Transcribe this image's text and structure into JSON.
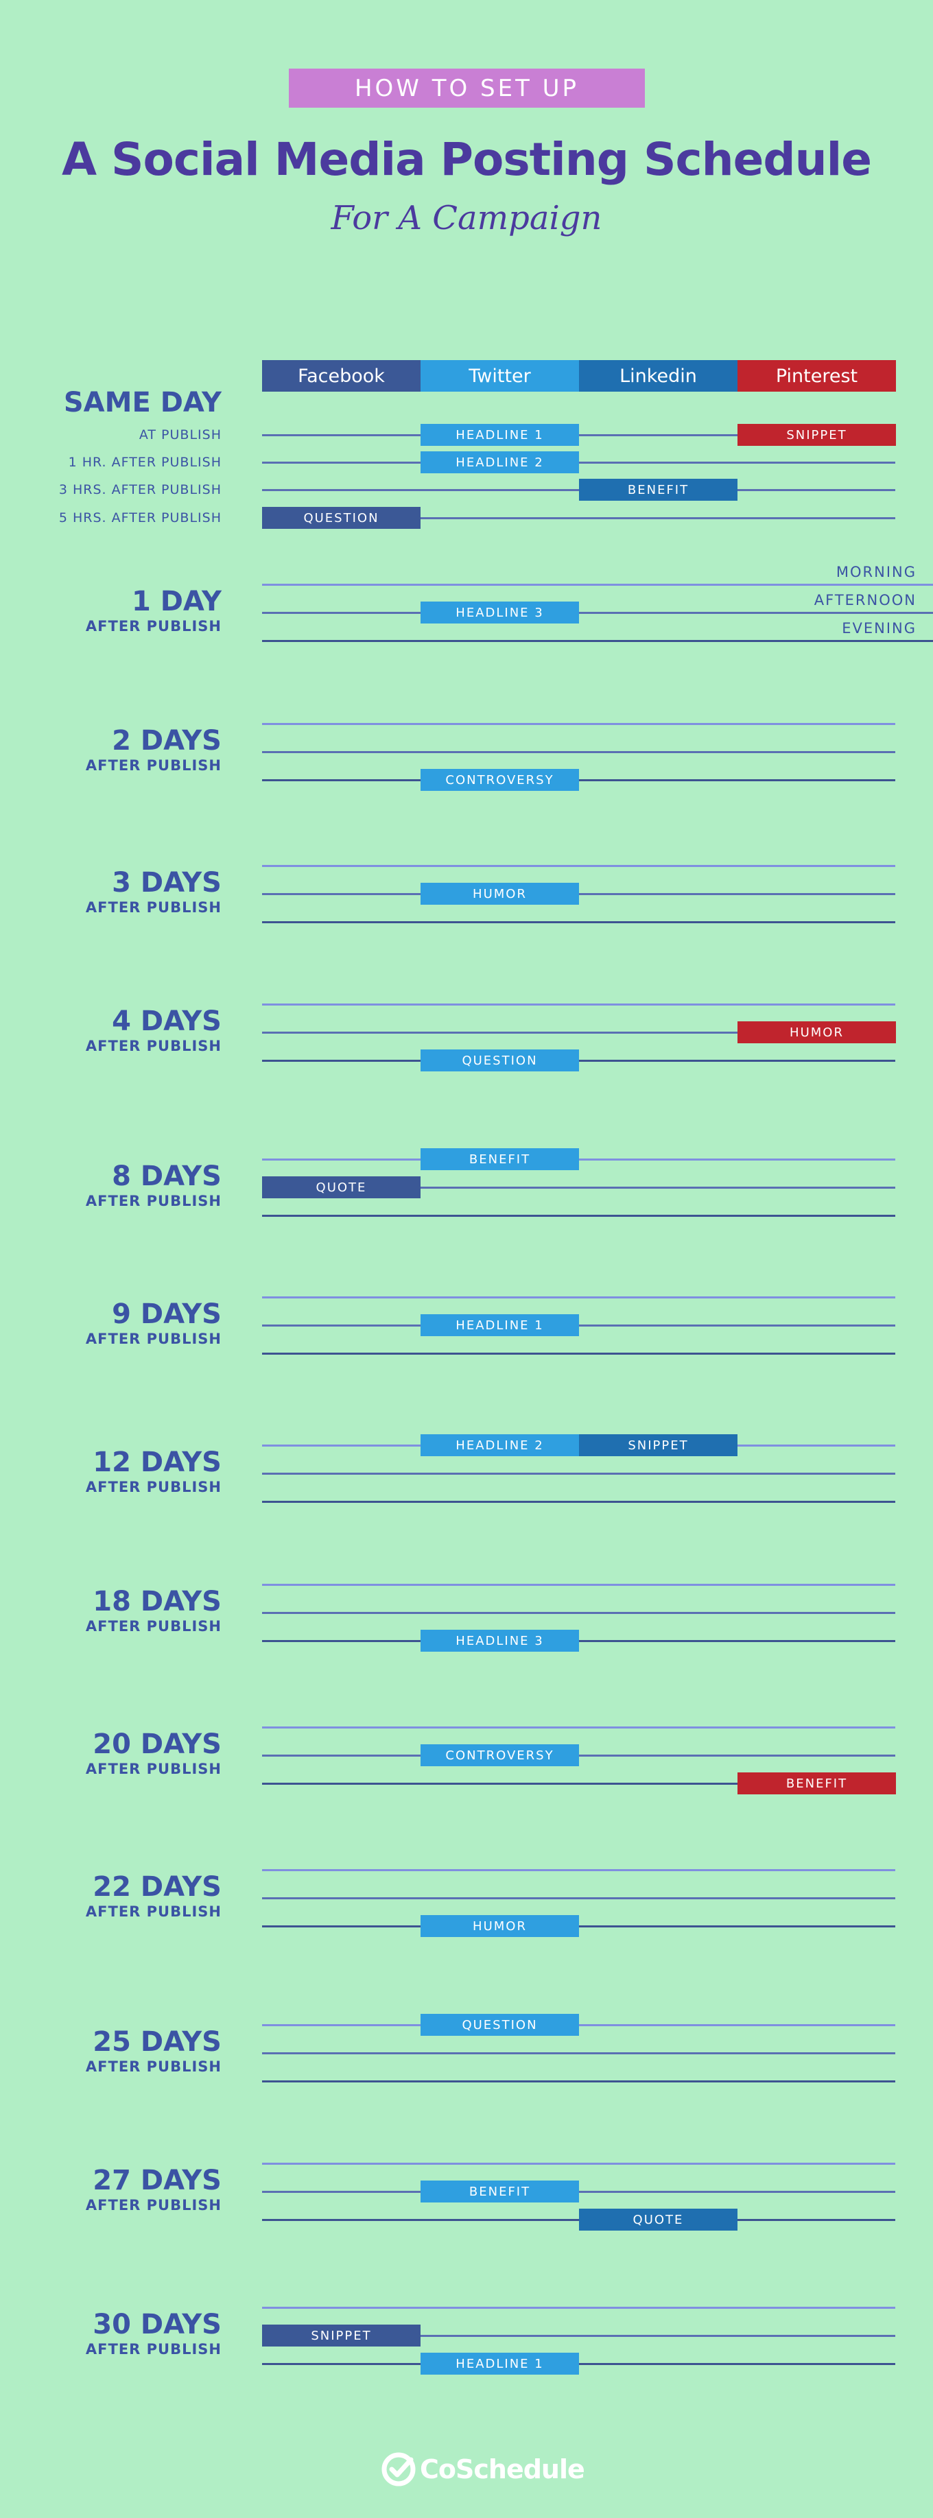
{
  "header": {
    "banner": "HOW TO SET UP",
    "title": "A Social Media Posting Schedule",
    "subtitle": "For A Campaign"
  },
  "colors": {
    "background": "#b1eec5",
    "banner": "#c97fd4",
    "title": "#4b3a9e",
    "label": "#3b53a4",
    "line_light": "#7f8fe0",
    "line_mid": "#5a6fb3",
    "line_dark": "#3d5391",
    "facebook": "#3b5896",
    "twitter": "#2f9fe0",
    "linkedin": "#1f6fb0",
    "pinterest": "#c0242d"
  },
  "columns": [
    {
      "key": "facebook",
      "label": "Facebook",
      "color": "#3b5896"
    },
    {
      "key": "twitter",
      "label": "Twitter",
      "color": "#2f9fe0"
    },
    {
      "key": "linkedin",
      "label": "Linkedin",
      "color": "#1f6fb0"
    },
    {
      "key": "pinterest",
      "label": "Pinterest",
      "color": "#c0242d"
    }
  ],
  "legend": {
    "times_of_day": [
      "MORNING",
      "AFTERNOON",
      "EVENING"
    ]
  },
  "same_day": {
    "title": "SAME DAY",
    "rows": [
      {
        "label": "AT PUBLISH",
        "posts": [
          {
            "network": "twitter",
            "text": "HEADLINE 1"
          },
          {
            "network": "pinterest",
            "text": "SNIPPET"
          }
        ]
      },
      {
        "label": "1 HR. AFTER PUBLISH",
        "posts": [
          {
            "network": "twitter",
            "text": "HEADLINE 2"
          }
        ]
      },
      {
        "label": "3 HRS. AFTER PUBLISH",
        "posts": [
          {
            "network": "linkedin",
            "text": "BENEFIT"
          }
        ]
      },
      {
        "label": "5 HRS. AFTER PUBLISH",
        "posts": [
          {
            "network": "facebook",
            "text": "QUESTION"
          }
        ]
      }
    ]
  },
  "days": [
    {
      "title": "1 DAY",
      "subtitle": "AFTER PUBLISH",
      "posts": [
        {
          "slot": "afternoon",
          "network": "twitter",
          "text": "HEADLINE 3"
        }
      ]
    },
    {
      "title": "2 DAYS",
      "subtitle": "AFTER PUBLISH",
      "posts": [
        {
          "slot": "evening",
          "network": "twitter",
          "text": "CONTROVERSY"
        }
      ]
    },
    {
      "title": "3 DAYS",
      "subtitle": "AFTER PUBLISH",
      "posts": [
        {
          "slot": "afternoon",
          "network": "twitter",
          "text": "HUMOR"
        }
      ]
    },
    {
      "title": "4 DAYS",
      "subtitle": "AFTER PUBLISH",
      "posts": [
        {
          "slot": "afternoon",
          "network": "pinterest",
          "text": "HUMOR"
        },
        {
          "slot": "evening",
          "network": "twitter",
          "text": "QUESTION"
        }
      ]
    },
    {
      "title": "8 DAYS",
      "subtitle": "AFTER PUBLISH",
      "posts": [
        {
          "slot": "morning",
          "network": "twitter",
          "text": "BENEFIT"
        },
        {
          "slot": "afternoon",
          "network": "facebook",
          "text": "QUOTE"
        }
      ]
    },
    {
      "title": "9 DAYS",
      "subtitle": "AFTER PUBLISH",
      "posts": [
        {
          "slot": "afternoon",
          "network": "twitter",
          "text": "HEADLINE 1"
        }
      ]
    },
    {
      "title": "12 DAYS",
      "subtitle": "AFTER PUBLISH",
      "posts": [
        {
          "slot": "morning",
          "network": "twitter",
          "text": "HEADLINE 2"
        },
        {
          "slot": "morning",
          "network": "linkedin",
          "text": "SNIPPET"
        }
      ]
    },
    {
      "title": "18 DAYS",
      "subtitle": "AFTER PUBLISH",
      "posts": [
        {
          "slot": "evening",
          "network": "twitter",
          "text": "HEADLINE 3"
        }
      ]
    },
    {
      "title": "20 DAYS",
      "subtitle": "AFTER PUBLISH",
      "posts": [
        {
          "slot": "afternoon",
          "network": "twitter",
          "text": "CONTROVERSY"
        },
        {
          "slot": "evening",
          "network": "pinterest",
          "text": "BENEFIT"
        }
      ]
    },
    {
      "title": "22 DAYS",
      "subtitle": "AFTER PUBLISH",
      "posts": [
        {
          "slot": "evening",
          "network": "twitter",
          "text": "HUMOR"
        }
      ]
    },
    {
      "title": "25 DAYS",
      "subtitle": "AFTER PUBLISH",
      "posts": [
        {
          "slot": "morning",
          "network": "twitter",
          "text": "QUESTION"
        }
      ]
    },
    {
      "title": "27 DAYS",
      "subtitle": "AFTER PUBLISH",
      "posts": [
        {
          "slot": "afternoon",
          "network": "twitter",
          "text": "BENEFIT"
        },
        {
          "slot": "evening",
          "network": "linkedin",
          "text": "QUOTE"
        }
      ]
    },
    {
      "title": "30 DAYS",
      "subtitle": "AFTER PUBLISH",
      "posts": [
        {
          "slot": "afternoon",
          "network": "facebook",
          "text": "SNIPPET"
        },
        {
          "slot": "evening",
          "network": "twitter",
          "text": "HEADLINE 1"
        }
      ]
    }
  ],
  "footer": {
    "logo_text": "CoSchedule",
    "logo_icon": "coschedule-check-icon"
  }
}
